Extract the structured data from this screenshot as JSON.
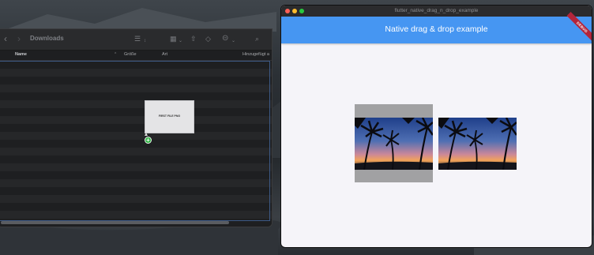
{
  "finder": {
    "folder_title": "Downloads",
    "columns": {
      "name": "Name",
      "size": "Größe",
      "kind": "Art",
      "added": "Hinzugefügt a"
    },
    "icons": [
      "back-chevron-icon",
      "forward-chevron-icon",
      "list-view-icon",
      "grid-view-icon",
      "share-icon",
      "tag-icon",
      "action-menu-icon",
      "search-icon"
    ]
  },
  "drag": {
    "thumbnail_text": "FIRST FILE PNG",
    "badge_symbol": "+"
  },
  "app": {
    "window_title": "flutter_native_drag_n_drop_example",
    "appbar_title": "Native drag & drop example",
    "debug_banner": "DEBUG",
    "colors": {
      "appbar": "#4696f2",
      "background": "#f5f4f9",
      "drop_target": "#a1a1a3",
      "debug_banner": "#b3263b"
    }
  }
}
